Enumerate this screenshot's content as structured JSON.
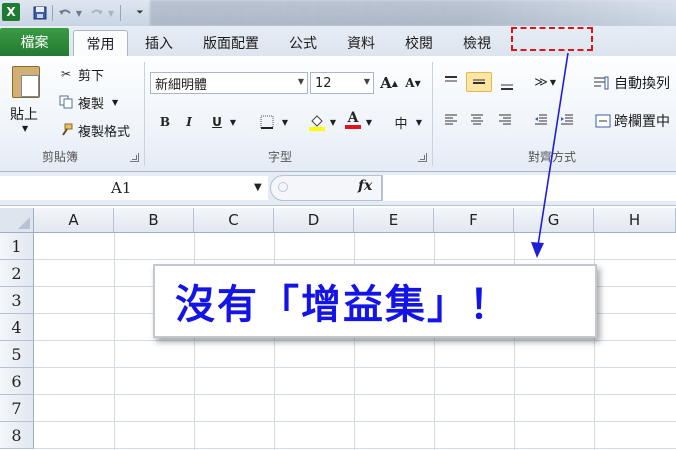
{
  "quick_access": {
    "excel_icon": "excel-logo-icon",
    "save_icon": "save-icon",
    "undo_icon": "undo-icon",
    "redo_icon": "redo-icon",
    "customize_icon": "customize-dropdown-icon"
  },
  "tabs": {
    "file": "檔案",
    "home": "常用",
    "insert": "插入",
    "page_layout": "版面配置",
    "formulas": "公式",
    "data": "資料",
    "review": "校閱",
    "view": "檢視"
  },
  "clipboard": {
    "paste": "貼上",
    "cut": "剪下",
    "copy": "複製",
    "format_painter": "複製格式",
    "group_label": "剪貼簿"
  },
  "font": {
    "name": "新細明體",
    "size": "12",
    "grow": "A",
    "shrink": "A",
    "bold": "B",
    "italic": "I",
    "underline": "U",
    "font_color_letter": "A",
    "phonetic": "中",
    "group_label": "字型"
  },
  "alignment": {
    "wrap_text": "自動換列",
    "merge_center": "跨欄置中",
    "group_label": "對齊方式"
  },
  "formula_bar": {
    "name_box": "A1",
    "fx": "fx"
  },
  "columns": [
    "A",
    "B",
    "C",
    "D",
    "E",
    "F",
    "G",
    "H"
  ],
  "rows": [
    "1",
    "2",
    "3",
    "4",
    "5",
    "6",
    "7",
    "8"
  ],
  "callout": {
    "text": "沒有「增益集」！"
  },
  "colors": {
    "file_tab": "#2d8b3a",
    "callout_text": "#1414e6",
    "dashed_box": "#e0141c",
    "arrow": "#1f1fd6"
  }
}
